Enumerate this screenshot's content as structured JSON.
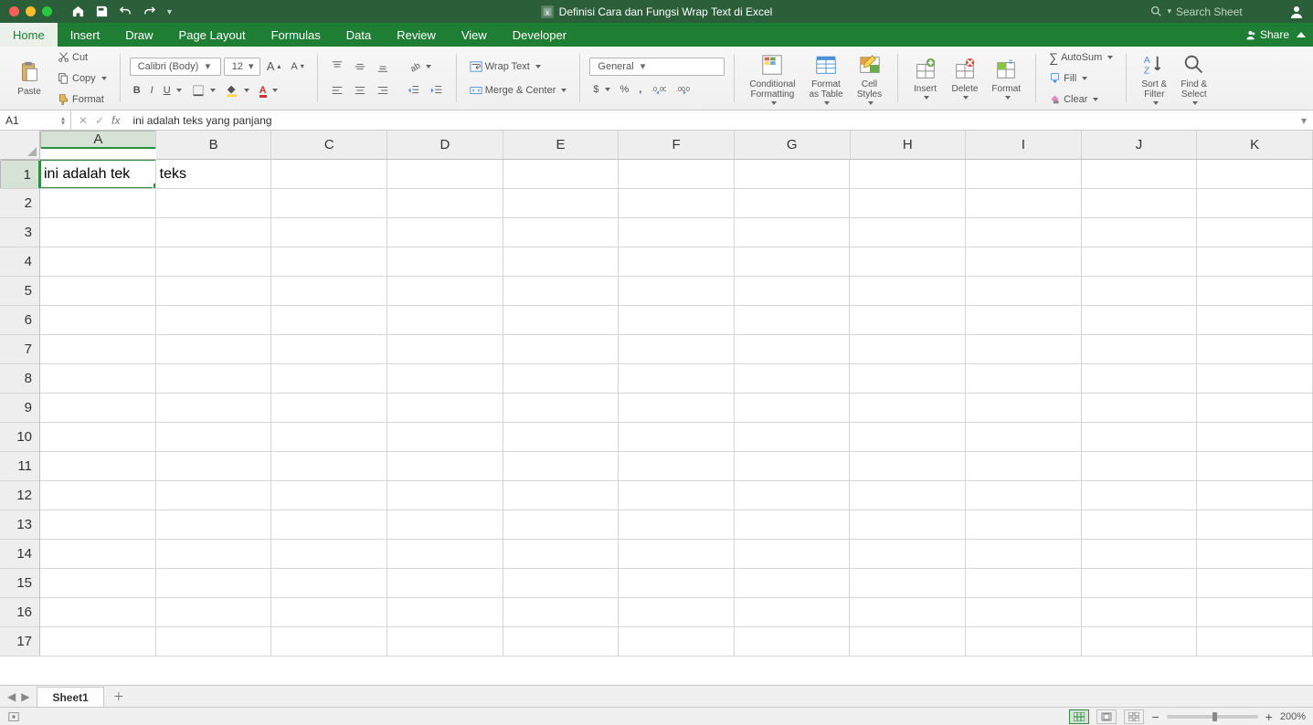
{
  "titlebar": {
    "title": "Definisi Cara dan Fungsi Wrap Text di Excel",
    "search_placeholder": "Search Sheet"
  },
  "tabs": {
    "items": [
      "Home",
      "Insert",
      "Draw",
      "Page Layout",
      "Formulas",
      "Data",
      "Review",
      "View",
      "Developer"
    ],
    "active": "Home",
    "share": "Share"
  },
  "ribbon": {
    "paste": "Paste",
    "cut": "Cut",
    "copy": "Copy",
    "format_painter": "Format",
    "font_name": "Calibri (Body)",
    "font_size": "12",
    "wrap_text": "Wrap Text",
    "merge_center": "Merge & Center",
    "number_format": "General",
    "cond_fmt": "Conditional\nFormatting",
    "fmt_table": "Format\nas Table",
    "cell_styles": "Cell\nStyles",
    "insert": "Insert",
    "delete": "Delete",
    "format": "Format",
    "autosum": "AutoSum",
    "fill": "Fill",
    "clear": "Clear",
    "sort_filter": "Sort &\nFilter",
    "find_select": "Find &\nSelect"
  },
  "formula_bar": {
    "cell_ref": "A1",
    "formula": "ini adalah teks yang panjang"
  },
  "grid": {
    "columns": [
      "A",
      "B",
      "C",
      "D",
      "E",
      "F",
      "G",
      "H",
      "I",
      "J",
      "K"
    ],
    "rows": 17,
    "sel_col": 0,
    "sel_row": 0,
    "cells": {
      "A1": "ini adalah tek",
      "B1": "teks"
    }
  },
  "sheetbar": {
    "tab": "Sheet1"
  },
  "status": {
    "zoom": "200%"
  }
}
